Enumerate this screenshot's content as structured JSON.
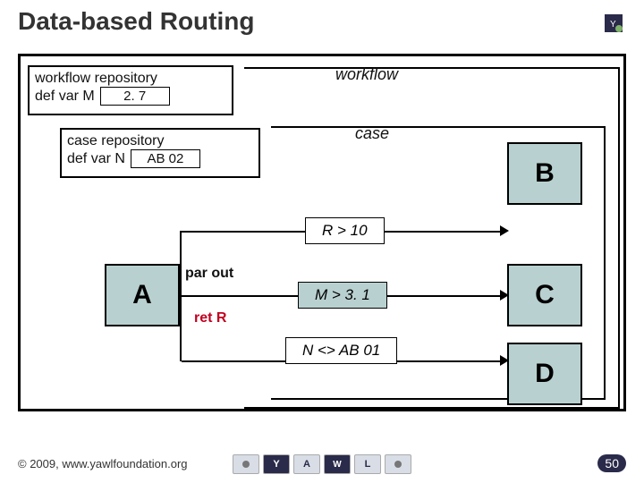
{
  "title": "Data-based Routing",
  "workflow_repo": {
    "label": "workflow repository",
    "var_label": "def var M",
    "value": "2. 7"
  },
  "case_repo": {
    "label": "case repository",
    "var_label": "def var N",
    "value": "AB 02"
  },
  "scope_labels": {
    "workflow": "workflow",
    "case": "case"
  },
  "nodes": {
    "A": "A",
    "B": "B",
    "C": "C",
    "D": "D"
  },
  "tags": {
    "par_out": "par out",
    "ret_r": "ret R"
  },
  "conditions": {
    "b": "R > 10",
    "c": "M > 3. 1",
    "d": "N <> AB 01"
  },
  "footer": {
    "copyright": "© 2009, www.yawlfoundation.org",
    "page": "50"
  },
  "logo_letters": {
    "y": "Y",
    "a": "A",
    "w": "W",
    "l": "L"
  },
  "chart_data": {
    "type": "table",
    "title": "Data-based Routing",
    "nodes": [
      "A",
      "B",
      "C",
      "D"
    ],
    "edges": [
      {
        "from": "A",
        "to": "B",
        "condition": "R > 10"
      },
      {
        "from": "A",
        "to": "C",
        "condition": "M > 3.1"
      },
      {
        "from": "A",
        "to": "D",
        "condition": "N <> AB01"
      }
    ],
    "repositories": [
      {
        "scope": "workflow",
        "variable": "M",
        "value": "2.7"
      },
      {
        "scope": "case",
        "variable": "N",
        "value": "AB02"
      }
    ],
    "taskA_annotations": [
      "par out",
      "ret R"
    ]
  }
}
